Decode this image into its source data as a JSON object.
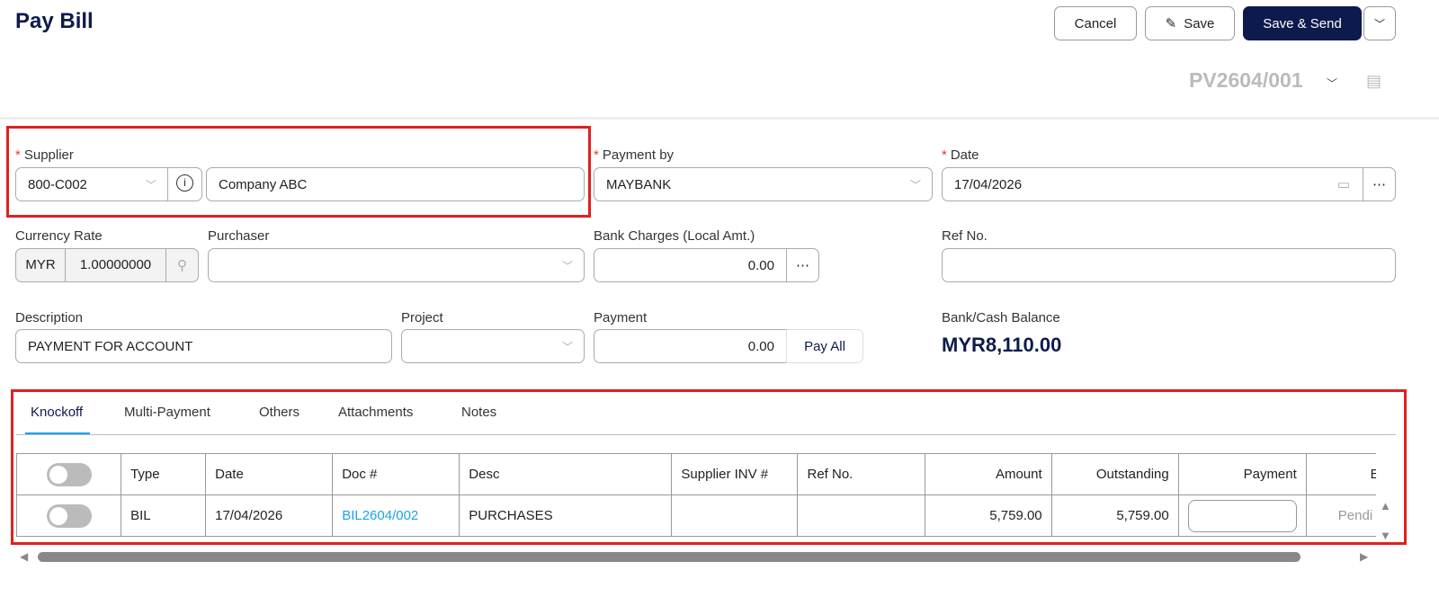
{
  "header": {
    "title": "Pay Bill",
    "cancel": "Cancel",
    "save": "Save",
    "save_send": "Save & Send",
    "doc_no": "PV2604/001"
  },
  "form": {
    "supplier": {
      "label": "Supplier",
      "code": "800-C002",
      "name": "Company ABC"
    },
    "payment_by": {
      "label": "Payment by",
      "value": "MAYBANK"
    },
    "date": {
      "label": "Date",
      "value": "17/04/2026"
    },
    "currency_rate": {
      "label": "Currency Rate",
      "currency": "MYR",
      "rate": "1.00000000"
    },
    "purchaser": {
      "label": "Purchaser",
      "value": ""
    },
    "bank_charges": {
      "label": "Bank Charges (Local Amt.)",
      "value": "0.00"
    },
    "ref_no": {
      "label": "Ref No.",
      "value": ""
    },
    "description": {
      "label": "Description",
      "value": "PAYMENT FOR ACCOUNT"
    },
    "project": {
      "label": "Project",
      "value": ""
    },
    "payment": {
      "label": "Payment",
      "value": "0.00",
      "pay_all": "Pay All"
    },
    "balance": {
      "label": "Bank/Cash Balance",
      "value": "MYR8,110.00"
    }
  },
  "tabs": [
    "Knockoff",
    "Multi-Payment",
    "Others",
    "Attachments",
    "Notes"
  ],
  "table": {
    "headers": [
      "Type",
      "Date",
      "Doc #",
      "Desc",
      "Supplier INV #",
      "Ref No.",
      "Amount",
      "Outstanding",
      "Payment",
      "E-Invo"
    ],
    "rows": [
      {
        "type": "BIL",
        "date": "17/04/2026",
        "doc": "BIL2604/002",
        "desc": "PURCHASES",
        "supplier_inv": "",
        "ref": "",
        "amount": "5,759.00",
        "outstanding": "5,759.00",
        "einvoice": "Pendi"
      }
    ]
  },
  "colors": {
    "primary": "#0d1b4c",
    "link": "#1aa3e8",
    "highlight": "#e02020"
  }
}
